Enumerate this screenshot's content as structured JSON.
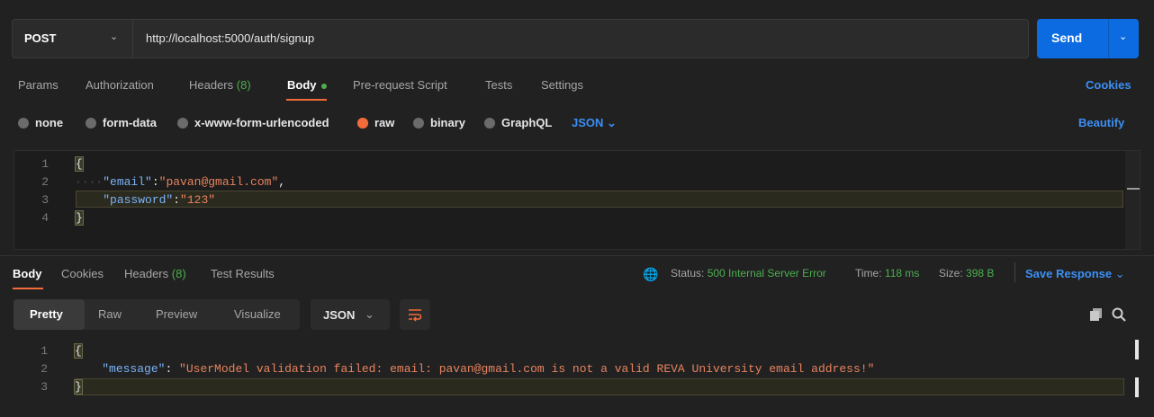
{
  "request": {
    "method": "POST",
    "url": "http://localhost:5000/auth/signup",
    "send_label": "Send"
  },
  "request_tabs": [
    {
      "label": "Params"
    },
    {
      "label": "Authorization"
    },
    {
      "label": "Headers",
      "count": "(8)"
    },
    {
      "label": "Body"
    },
    {
      "label": "Pre-request Script"
    },
    {
      "label": "Tests"
    },
    {
      "label": "Settings"
    }
  ],
  "cookies_label": "Cookies",
  "body_types": [
    "none",
    "form-data",
    "x-www-form-urlencoded",
    "raw",
    "binary",
    "GraphQL"
  ],
  "body_format": "JSON",
  "beautify_label": "Beautify",
  "request_body": {
    "line_numbers": [
      "1",
      "2",
      "3",
      "4"
    ],
    "open": "{",
    "email_key": "\"email\"",
    "email_val": "\"pavan@gmail.com\"",
    "password_key": "\"password\"",
    "password_val": "\"123\"",
    "close": "}"
  },
  "response_tabs": [
    {
      "label": "Body"
    },
    {
      "label": "Cookies"
    },
    {
      "label": "Headers",
      "count": "(8)"
    },
    {
      "label": "Test Results"
    }
  ],
  "status": {
    "status_label": "Status:",
    "status_value": "500 Internal Server Error",
    "time_label": "Time:",
    "time_value": "118 ms",
    "size_label": "Size:",
    "size_value": "398 B",
    "save_label": "Save Response"
  },
  "view_tabs": [
    "Pretty",
    "Raw",
    "Preview",
    "Visualize"
  ],
  "response_format": "JSON",
  "response_body": {
    "line_numbers": [
      "1",
      "2",
      "3"
    ],
    "open": "{",
    "message_key": "\"message\"",
    "message_val": "\"UserModel validation failed: email: pavan@gmail.com is not a valid REVA University email address!\"",
    "close": "}"
  },
  "colors": {
    "accent": "#f26b3a",
    "link": "#3c8ff5",
    "send": "#0c6be0",
    "status_error": "#4caf50"
  }
}
